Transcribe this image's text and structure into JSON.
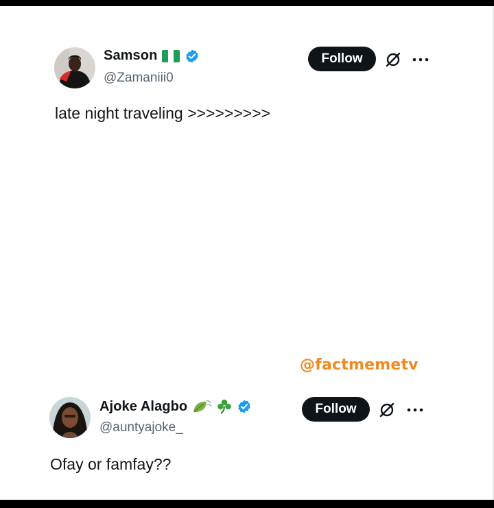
{
  "tweets": [
    {
      "name": "Samson",
      "handle": "@Zamaniii0",
      "follow_label": "Follow",
      "text": "late night traveling >>>>>>>>>",
      "name_emoji": "nigeria-flag",
      "verified_color": "#1d9bf0"
    },
    {
      "name": "Ajoke Alagbo",
      "handle": "@auntyajoke_",
      "follow_label": "Follow",
      "text": "Ofay or famfay??",
      "name_emoji": "leaf-wind-and-shamrock",
      "verified_color": "#1d9bf0"
    }
  ],
  "watermark": "@factmemetv",
  "colors": {
    "background": "#ffffff",
    "follow_button": "#0f1419",
    "handle": "#536471",
    "watermark": "#f08a1f"
  }
}
